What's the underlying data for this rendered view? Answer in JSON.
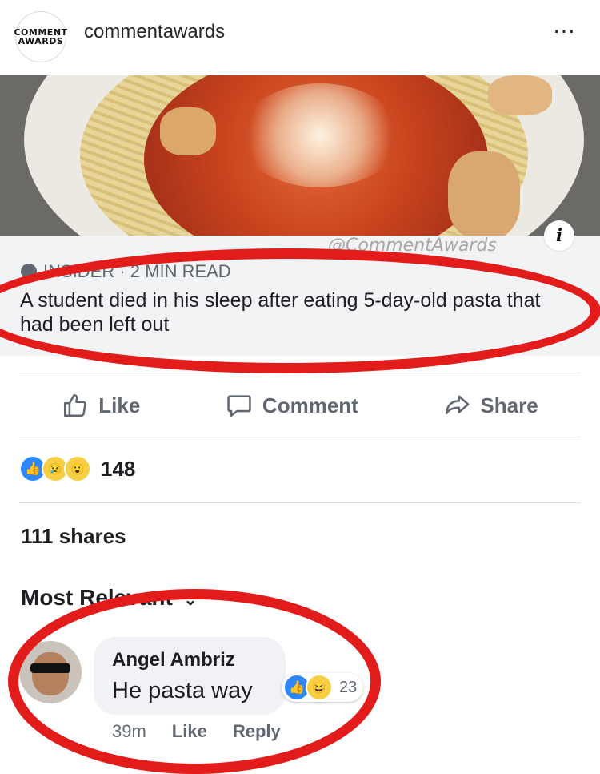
{
  "instagram": {
    "account_name": "commentawards",
    "avatar_text_top": "COMMENT",
    "avatar_text_bottom": "AWARDS",
    "more_icon": "⋯"
  },
  "link_preview": {
    "watermark": "@CommentAwards",
    "source": "INSIDER · 2 MIN READ",
    "headline": "A student died in his sleep after eating 5-day-old pasta that had been left out"
  },
  "actions": {
    "like_label": "Like",
    "comment_label": "Comment",
    "share_label": "Share"
  },
  "reactions": {
    "count": "148",
    "icons": [
      "like-icon",
      "sad-icon",
      "wow-icon"
    ]
  },
  "shares_text": "111 shares",
  "sort_label": "Most Relevant",
  "comment": {
    "author": "Angel Ambriz",
    "text": "He pasta way",
    "reaction_count": "23",
    "time": "39m",
    "like_label": "Like",
    "reply_label": "Reply"
  },
  "colors": {
    "annotation_red": "#e21b1b",
    "facebook_blue": "#2d88ff",
    "muted_text": "#606770"
  }
}
